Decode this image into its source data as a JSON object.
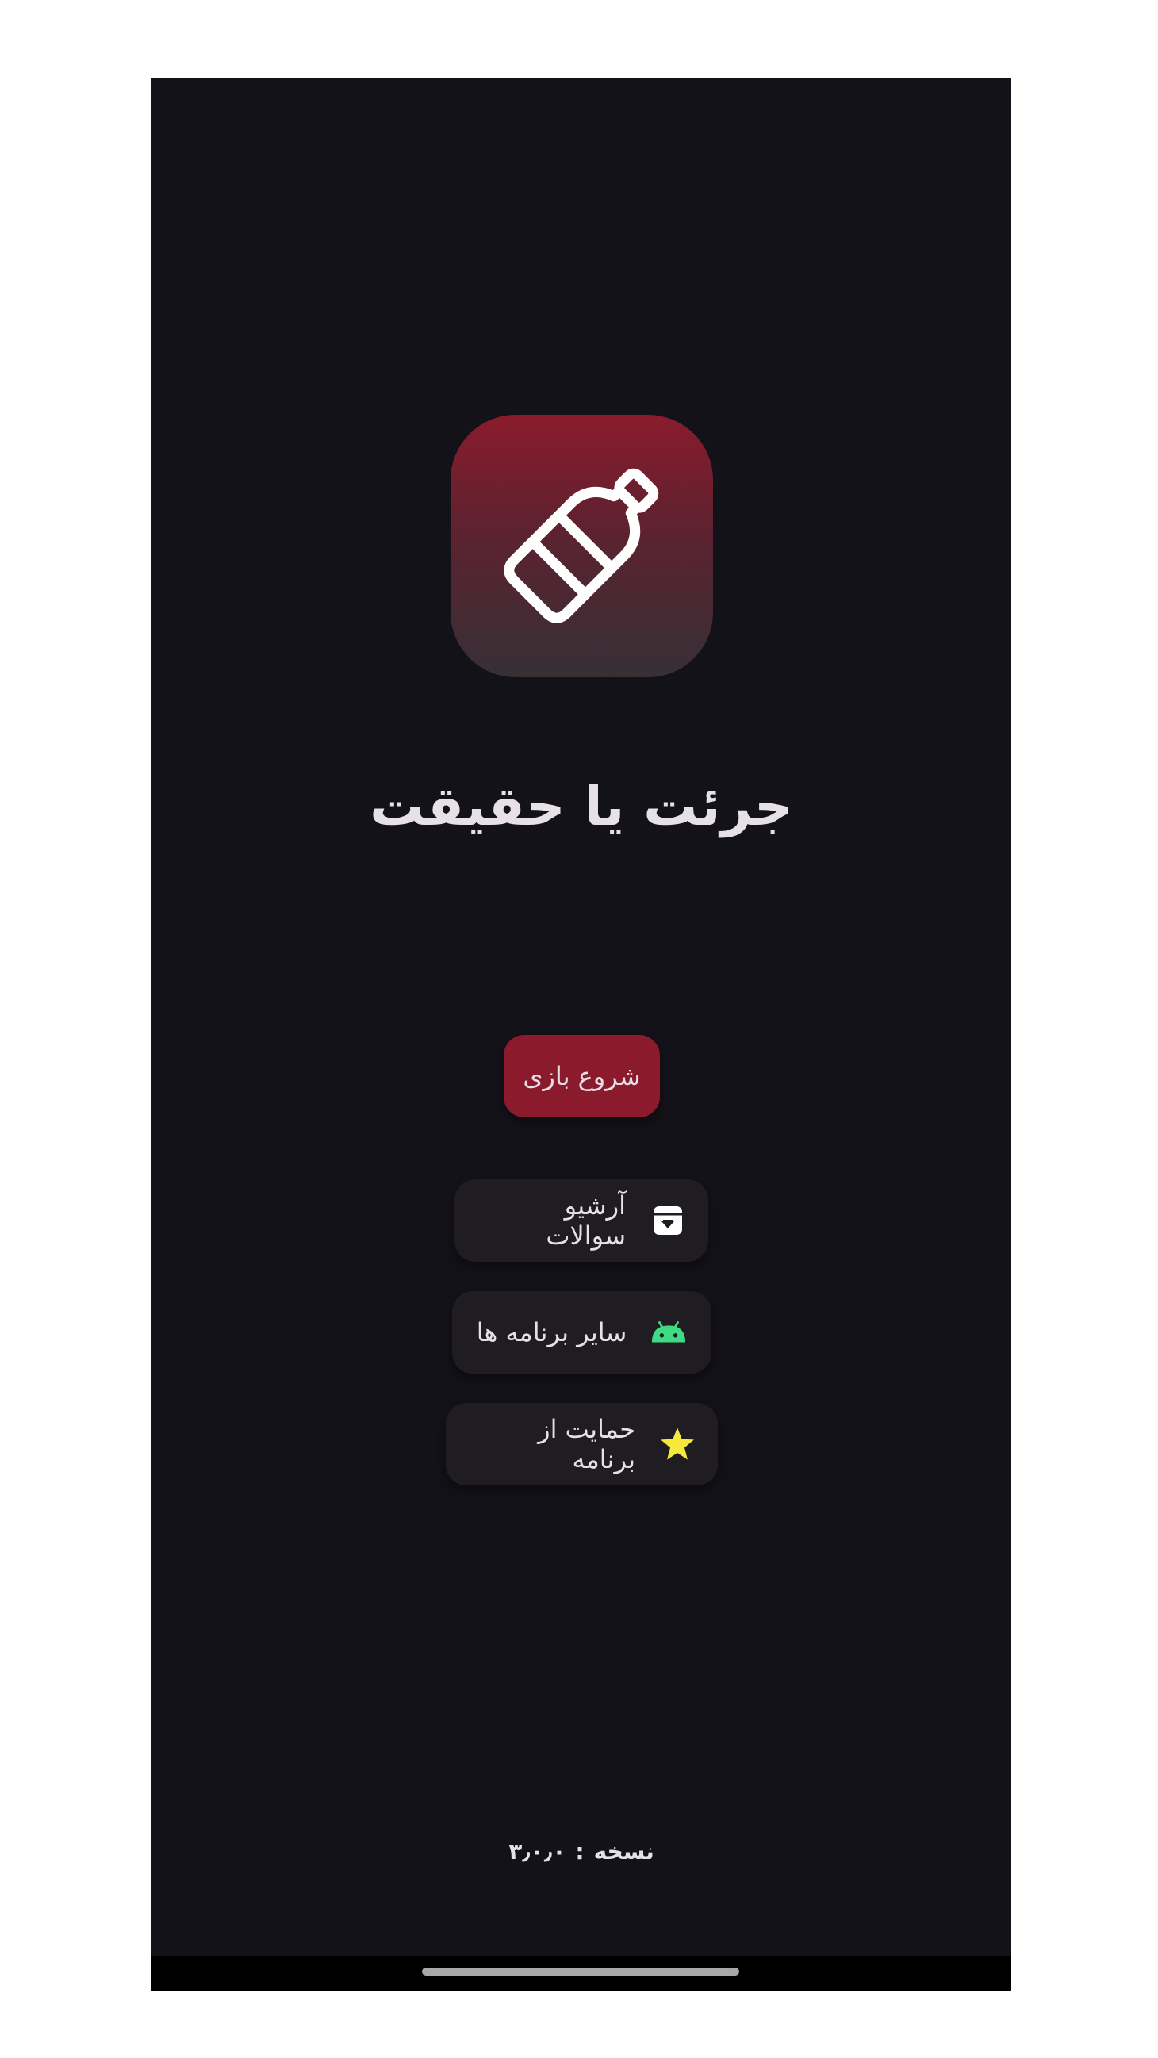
{
  "app": {
    "title": "جرئت یا حقیقت",
    "icon": "bottle-icon"
  },
  "buttons": {
    "start_label": "شروع بازی",
    "archive_label": "آرشیو سوالات",
    "archive_icon": "archive-box-icon",
    "apps_label": "سایر برنامه ها",
    "apps_icon": "android-icon",
    "support_label": "حمایت از برنامه",
    "support_icon": "star-icon"
  },
  "version": {
    "label": "نسخه",
    "separator": ":",
    "value": "۳٫۰٫۰"
  },
  "colors": {
    "background": "#141219",
    "primary": "#8b1a2c",
    "surface": "#1f1d22",
    "text": "#e6e1e6",
    "android_green": "#3ddc84",
    "star_yellow": "#f7e93b"
  }
}
